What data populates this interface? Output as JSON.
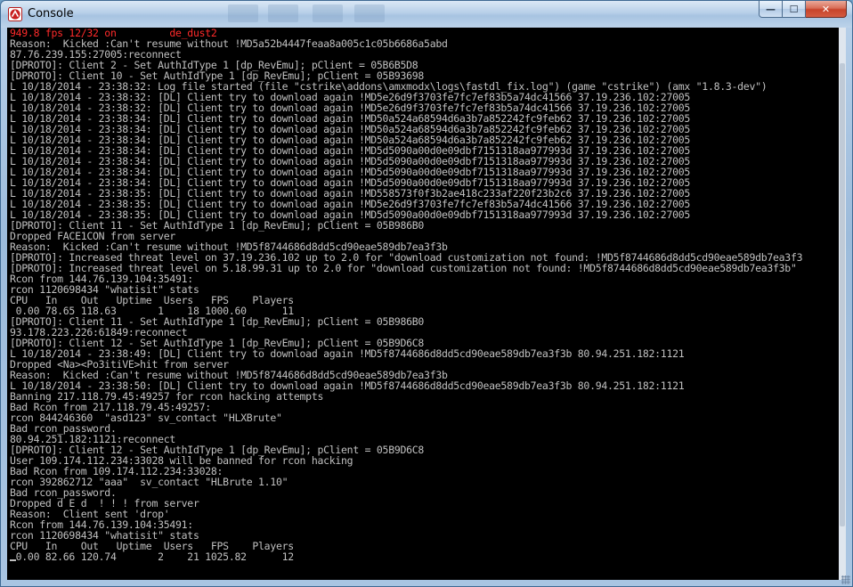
{
  "window": {
    "title": "Console"
  },
  "console": {
    "status_line": "949.8 fps 12/32 on         de_dust2",
    "lines": [
      "Reason:  Kicked :Can't resume without !MD5a52b4447feaa8a005c1c05b6686a5abd",
      "87.76.239.155:27005:reconnect",
      "[DPROTO]: Client 2 - Set AuthIdType 1 [dp_RevEmu]; pClient = 05B6B5D8",
      "[DPROTO]: Client 10 - Set AuthIdType 1 [dp_RevEmu]; pClient = 05B93698",
      "L 10/18/2014 - 23:38:32: Log file started (file \"cstrike\\addons\\amxmodx\\logs\\fastdl_fix.log\") (game \"cstrike\") (amx \"1.8.3-dev\")",
      "L 10/18/2014 - 23:38:32: [DL] Client try to download again !MD5e26d9f3703fe7fc7ef83b5a74dc41566 37.19.236.102:27005",
      "L 10/18/2014 - 23:38:32: [DL] Client try to download again !MD5e26d9f3703fe7fc7ef83b5a74dc41566 37.19.236.102:27005",
      "L 10/18/2014 - 23:38:34: [DL] Client try to download again !MD50a524a68594d6a3b7a852242fc9feb62 37.19.236.102:27005",
      "L 10/18/2014 - 23:38:34: [DL] Client try to download again !MD50a524a68594d6a3b7a852242fc9feb62 37.19.236.102:27005",
      "L 10/18/2014 - 23:38:34: [DL] Client try to download again !MD50a524a68594d6a3b7a852242fc9feb62 37.19.236.102:27005",
      "L 10/18/2014 - 23:38:34: [DL] Client try to download again !MD5d5090a00d0e09dbf7151318aa977993d 37.19.236.102:27005",
      "L 10/18/2014 - 23:38:34: [DL] Client try to download again !MD5d5090a00d0e09dbf7151318aa977993d 37.19.236.102:27005",
      "L 10/18/2014 - 23:38:34: [DL] Client try to download again !MD5d5090a00d0e09dbf7151318aa977993d 37.19.236.102:27005",
      "L 10/18/2014 - 23:38:34: [DL] Client try to download again !MD5d5090a00d0e09dbf7151318aa977993d 37.19.236.102:27005",
      "L 10/18/2014 - 23:38:35: [DL] Client try to download again !MD558573f0f3b2ae418c233af220f23b2c6 37.19.236.102:27005",
      "L 10/18/2014 - 23:38:35: [DL] Client try to download again !MD5e26d9f3703fe7fc7ef83b5a74dc41566 37.19.236.102:27005",
      "L 10/18/2014 - 23:38:35: [DL] Client try to download again !MD5d5090a00d0e09dbf7151318aa977993d 37.19.236.102:27005",
      "[DPROTO]: Client 11 - Set AuthIdType 1 [dp_RevEmu]; pClient = 05B986B0",
      "Dropped FACE1CON from server",
      "Reason:  Kicked :Can't resume without !MD5f8744686d8dd5cd90eae589db7ea3f3b",
      "[DPROTO]: Increased threat level on 37.19.236.102 up to 2.0 for \"download customization not found: !MD5f8744686d8dd5cd90eae589db7ea3f3",
      "[DPROTO]: Increased threat level on 5.18.99.31 up to 2.0 for \"download customization not found: !MD5f8744686d8dd5cd90eae589db7ea3f3b\"",
      "Rcon from 144.76.139.104:35491:",
      "rcon 1120698434 \"whatisit\" stats",
      "CPU   In    Out   Uptime  Users   FPS    Players",
      " 0.00 78.65 118.63       1    18 1000.60      11",
      "[DPROTO]: Client 11 - Set AuthIdType 1 [dp_RevEmu]; pClient = 05B986B0",
      "93.178.223.226:61849:reconnect",
      "[DPROTO]: Client 12 - Set AuthIdType 1 [dp_RevEmu]; pClient = 05B9D6C8",
      "L 10/18/2014 - 23:38:49: [DL] Client try to download again !MD5f8744686d8dd5cd90eae589db7ea3f3b 80.94.251.182:1121",
      "Dropped <Na><Po3itiVE>hit from server",
      "Reason:  Kicked :Can't resume without !MD5f8744686d8dd5cd90eae589db7ea3f3b",
      "L 10/18/2014 - 23:38:50: [DL] Client try to download again !MD5f8744686d8dd5cd90eae589db7ea3f3b 80.94.251.182:1121",
      "Banning 217.118.79.45:49257 for rcon hacking attempts",
      "Bad Rcon from 217.118.79.45:49257:",
      "rcon 844246360  \"asd123\" sv_contact \"HLXBrute\"",
      "Bad rcon_password.",
      "80.94.251.182:1121:reconnect",
      "[DPROTO]: Client 12 - Set AuthIdType 1 [dp_RevEmu]; pClient = 05B9D6C8",
      "User 109.174.112.234:33028 will be banned for rcon hacking",
      "Bad Rcon from 109.174.112.234:33028:",
      "rcon 392862712 \"aaa\"  sv_contact \"HLBrute 1.10\"",
      "Bad rcon_password.",
      "Dropped d E d  ! ! ! from server",
      "Reason:  Client sent 'drop'",
      "Rcon from 144.76.139.104:35491:",
      "rcon 1120698434 \"whatisit\" stats",
      "CPU   In    Out   Uptime  Users   FPS    Players",
      " 0.00 82.66 120.74       2    21 1025.82      12"
    ]
  },
  "controls": {
    "minimize": "—",
    "maximize": "☐",
    "close": "✕"
  }
}
